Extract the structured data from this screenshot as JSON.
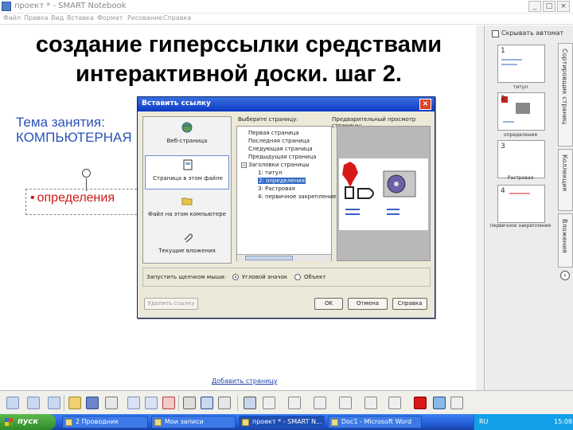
{
  "window": {
    "title": "проект * - SMART Notebook",
    "menu": [
      "Файл",
      "Правка",
      "Вид",
      "Вставка",
      "Формат",
      "Рисование",
      "Справка"
    ]
  },
  "slide": {
    "title_line1": "создание гиперссылки средствами",
    "title_line2": "интерактивной доски. шаг 2.",
    "topic_line1": "Тема занятия:",
    "topic_line2": "КОМПЬЮТЕРНАЯ",
    "definition_bullet": "•",
    "definition_text": "определения",
    "bottom_link": "Добавить страницу"
  },
  "sidepanel": {
    "autohide_label": "Скрывать автомат",
    "thumbs": [
      {
        "num": "1",
        "label": "титул"
      },
      {
        "num": "2",
        "label": "определения"
      },
      {
        "num": "3",
        "label": "Растровая"
      },
      {
        "num": "4",
        "label": "первичное закрепление"
      }
    ],
    "tabs": [
      "Сортировщик страниц",
      "Коллекция",
      "Вложения"
    ]
  },
  "dialog": {
    "title": "Вставить ссылку",
    "close_label": "×",
    "options": [
      {
        "label": "Веб-страница"
      },
      {
        "label": "Страница в этом файле"
      },
      {
        "label": "Файл на этом компьютере"
      },
      {
        "label": "Текущие вложения"
      }
    ],
    "select_label": "Выберите страницу:",
    "preview_label": "Предварительный просмотр страницы:",
    "tree": [
      "Первая страница",
      "Последняя страница",
      "Следующая страница",
      "Предыдущая страница",
      "Заголовки страницы",
      "1: титул",
      "2: определения",
      "3: Растровая",
      "4: первичное закрепление"
    ],
    "tree_expander": "−",
    "selected_tree_index": 6,
    "bottom_label": "Запустить щелчком мыши:",
    "radio_icon_label": "Угловой значок",
    "radio_object_label": "Объект",
    "remove_link": "Удалить ссылку",
    "ok": "OK",
    "cancel": "Отмена",
    "help": "Справка"
  },
  "taskbar": {
    "start": "пуск",
    "tasks": [
      "2 Проводник",
      "Мои записи",
      "проект * - SMART N...",
      "Doc1 - Microsoft Word"
    ],
    "tray_lang": "RU",
    "time": "15:08"
  }
}
